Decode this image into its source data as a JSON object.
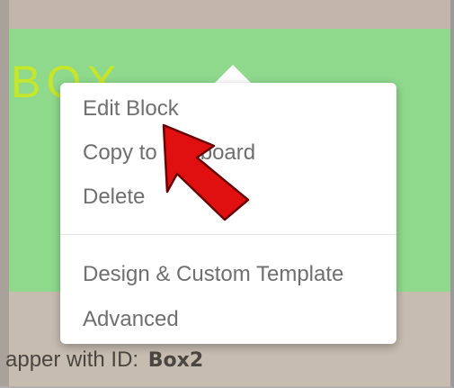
{
  "background": {
    "block_title": "BOX",
    "wrapper_label": "apper with ID:",
    "wrapper_id": "Box2"
  },
  "context_menu": {
    "items": [
      {
        "label": "Edit Block"
      },
      {
        "label": "Copy to Clipboard"
      },
      {
        "label": "Delete"
      },
      {
        "label": "Design & Custom Template"
      },
      {
        "label": "Advanced"
      }
    ]
  },
  "colors": {
    "block_background": "#8fd98d",
    "block_title": "#c6e62b",
    "page_background": "#c7bcb0",
    "menu_text": "#6f6f6f",
    "pointer_arrow": "#e01010"
  },
  "annotation": {
    "icon": "red-pointer-arrow-icon"
  }
}
